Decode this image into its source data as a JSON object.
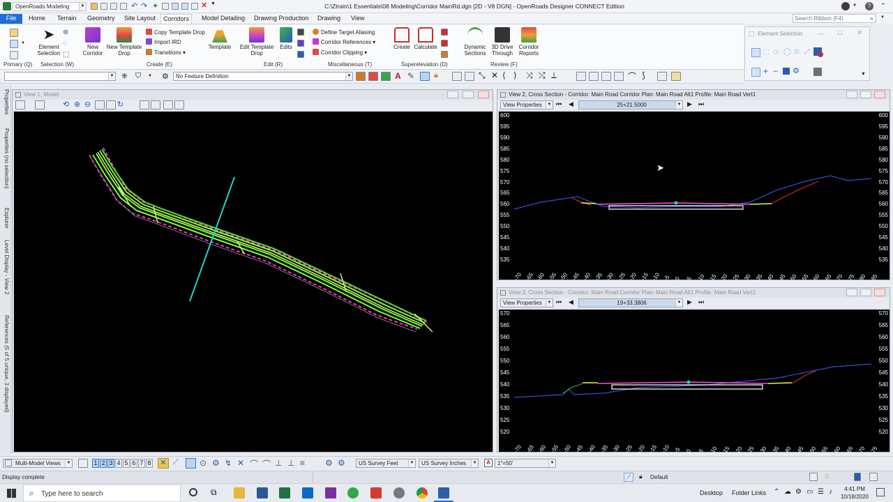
{
  "titlebar": {
    "workflow": "OpenRoads Modeling",
    "title": "C:\\Ztrain\\1 Essentials\\08 Modeling\\Corridor MainRd.dgn [2D - V8 DGN] - OpenRoads Designer CONNECT Edition",
    "search_placeholder": "Search Ribbon (F4)"
  },
  "tabs": [
    "File",
    "Home",
    "Terrain",
    "Geometry",
    "Site Layout",
    "Corridors",
    "Model Detailing",
    "Drawing Production",
    "Drawing",
    "View"
  ],
  "active_tab": "Corridors",
  "ribbon": {
    "primary": "Primary (Q)",
    "selection": {
      "element_selection": "Element Selection",
      "label": "Selection (W)"
    },
    "create": {
      "new_corridor": "New Corridor",
      "new_template_drop": "New Template Drop",
      "copy_template_drop": "Copy Template Drop",
      "import_ird": "Import IRD",
      "transitions": "Transitions",
      "template": "Template",
      "label": "Create (E)"
    },
    "edit": {
      "edit_template_drop": "Edit Template Drop",
      "edits": "Edits",
      "label": "Edit (R)"
    },
    "misc": {
      "define_target_aliasing": "Define Target Aliasing",
      "corridor_references": "Corridor References",
      "corridor_clipping": "Corridor Clipping",
      "label": "Miscellaneous (T)"
    },
    "superelevation": {
      "create": "Create",
      "calculate": "Calculate",
      "label": "Superelevation (D)"
    },
    "review": {
      "dynamic_sections": "Dynamic Sections",
      "drive_through": "3D Drive Through",
      "corridor_reports": "Corridor Reports",
      "label": "Review (F)"
    }
  },
  "element_selection": {
    "title": "Element Selection"
  },
  "toolbar2": {
    "feature_definition": "No Feature Definition"
  },
  "sidebar_tabs": [
    "Properties",
    "Properties (no selection)",
    "Explorer",
    "Level Display - View 2",
    "References (5 of 5 unique, 3 displayed)"
  ],
  "view1": {
    "title": "View 1, Model"
  },
  "view2": {
    "title": "View 2, Cross Section - Corridor: Main Road Corridor Plan: Main Road Alt1 Profile: Main Road Vert1",
    "view_properties": "View Properties",
    "station": "25+21.5000",
    "y_ticks": [
      "600",
      "595",
      "590",
      "585",
      "580",
      "575",
      "570",
      "565",
      "560",
      "555",
      "550",
      "545",
      "540",
      "535"
    ],
    "x_ticks": [
      "-70",
      "-65",
      "-60",
      "-55",
      "-50",
      "-45",
      "-40",
      "-35",
      "-30",
      "-25",
      "-20",
      "-15",
      "-10",
      "-5",
      "0",
      "5",
      "10",
      "15",
      "20",
      "25",
      "30",
      "35",
      "40",
      "45",
      "50",
      "55",
      "60",
      "65",
      "70",
      "75",
      "80",
      "85"
    ]
  },
  "view3": {
    "title": "View 3, Cross Section - Corridor: Main Road Corridor Plan: Main Road Alt1 Profile: Main Road Vert1",
    "view_properties": "View Properties",
    "station": "19+33.3806",
    "y_ticks": [
      "570",
      "565",
      "560",
      "555",
      "550",
      "545",
      "540",
      "535",
      "530",
      "525",
      "520"
    ],
    "x_ticks": [
      "-70",
      "-65",
      "-60",
      "-55",
      "-50",
      "-45",
      "-40",
      "-35",
      "-30",
      "-25",
      "-20",
      "-15",
      "-10",
      "-5",
      "0",
      "5",
      "10",
      "15",
      "20",
      "25",
      "30",
      "35",
      "40",
      "45",
      "50",
      "55",
      "60",
      "65",
      "70",
      "75"
    ]
  },
  "bottombar": {
    "views_menu": "Multi-Model Views",
    "view_numbers": [
      "1",
      "2",
      "3",
      "4",
      "5",
      "6",
      "7",
      "8"
    ],
    "units_feet": "US Survey Feet",
    "units_inches": "US Survey Inches",
    "scale": "1\"=50'"
  },
  "statusbar": {
    "message": "Display complete",
    "level": "Default"
  },
  "taskbar": {
    "search_placeholder": "Type here to search",
    "desktop": "Desktop",
    "folder_links": "Folder Links",
    "time": "4:41 PM",
    "date": "10/18/2020"
  },
  "colors": {
    "accent": "#1e6fd6",
    "canvas": "#000000",
    "corridor": "#7cff3a",
    "boundary": "#ff2bd6",
    "section_line": "#22d3c9"
  }
}
